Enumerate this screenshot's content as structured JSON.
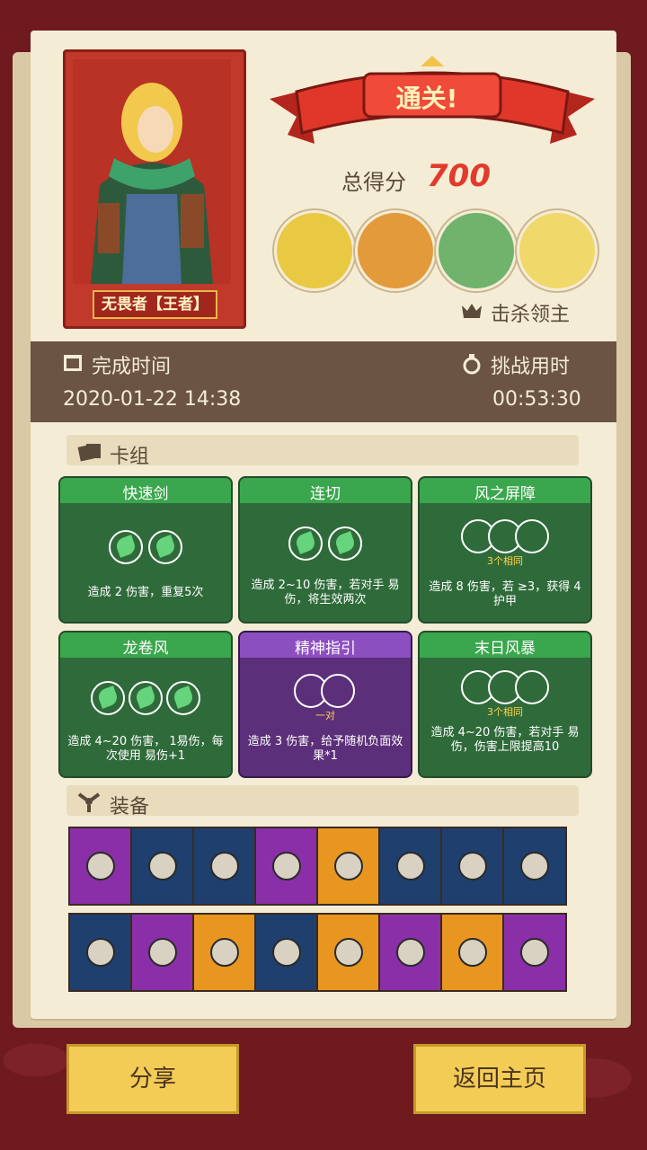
{
  "hero": {
    "name": "无畏者【王者】"
  },
  "result": {
    "title": "通关!",
    "score_label": "总得分",
    "score": "700",
    "kill_label": "击杀领主"
  },
  "time": {
    "finish_label": "完成时间",
    "finish_value": "2020-01-22 14:38",
    "challenge_label": "挑战用时",
    "challenge_value": "00:53:30"
  },
  "deck": {
    "title": "卡组",
    "cards": [
      {
        "name": "快速剑",
        "desc": "造成 2 伤害，重复5次",
        "color": "green",
        "sub": ""
      },
      {
        "name": "连切",
        "desc": "造成 2~10 伤害，若对手 易伤，将生效两次",
        "color": "green",
        "sub": ""
      },
      {
        "name": "风之屏障",
        "desc": "造成 8 伤害，若 ≥3，获得 4 护甲",
        "color": "green",
        "sub": "3个相同"
      },
      {
        "name": "龙卷风",
        "desc": "造成 4~20 伤害， 1易伤，每次使用 易伤+1",
        "color": "green",
        "sub": ""
      },
      {
        "name": "精神指引",
        "desc": "造成 3 伤害，给予随机负面效果*1",
        "color": "purple",
        "sub": "一对"
      },
      {
        "name": "末日风暴",
        "desc": "造成 4~20 伤害，若对手 易伤，伤害上限提高10",
        "color": "green",
        "sub": "3个相同"
      }
    ]
  },
  "equip": {
    "title": "装备",
    "row1": [
      {
        "icon": "gem-icon",
        "color": "purple"
      },
      {
        "icon": "jar-icon",
        "color": "blue"
      },
      {
        "icon": "shield-icon",
        "color": "blue"
      },
      {
        "icon": "scroll-icon",
        "color": "purple"
      },
      {
        "icon": "helmet-icon",
        "color": "orange"
      },
      {
        "icon": "bracer-icon",
        "color": "blue"
      },
      {
        "icon": "round-shield-icon",
        "color": "blue"
      },
      {
        "icon": "amulet-icon",
        "color": "blue"
      }
    ],
    "row2": [
      {
        "icon": "treasure-icon",
        "color": "blue"
      },
      {
        "icon": "wind-orb-icon",
        "color": "purple"
      },
      {
        "icon": "charm-icon",
        "color": "orange"
      },
      {
        "icon": "ring-icon",
        "color": "blue"
      },
      {
        "icon": "feather-icon",
        "color": "orange"
      },
      {
        "icon": "dagger-icon",
        "color": "purple"
      },
      {
        "icon": "stone-icon",
        "color": "orange"
      },
      {
        "icon": "tattered-cloth-icon",
        "color": "purple"
      }
    ]
  },
  "buttons": {
    "share": "分享",
    "home": "返回主页"
  }
}
